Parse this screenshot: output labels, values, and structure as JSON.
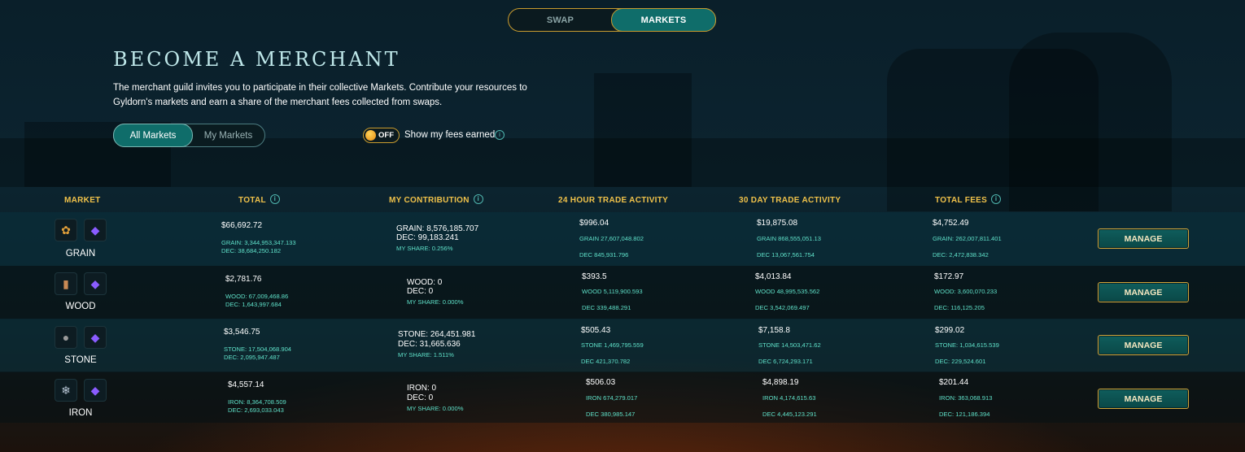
{
  "nav": {
    "tabs": [
      "SWAP",
      "MARKETS"
    ],
    "active": "MARKETS"
  },
  "page": {
    "title": "BECOME A MERCHANT",
    "description": "The merchant guild invites you to participate in their collective Markets. Contribute your resources to Gyldorn's markets and earn a share of the merchant fees collected from swaps."
  },
  "filter": {
    "all": "All Markets",
    "mine": "My Markets",
    "selected": "All Markets"
  },
  "fees_toggle": {
    "state": "OFF",
    "label": "Show my fees earned"
  },
  "columns": {
    "market": "MARKET",
    "total": "TOTAL",
    "contribution": "MY CONTRIBUTION",
    "day": "24 HOUR TRADE ACTIVITY",
    "month": "30 DAY TRADE ACTIVITY",
    "fees": "TOTAL FEES"
  },
  "markets": [
    {
      "name": "GRAIN",
      "resource_icon": "grain-icon",
      "token_icon": "dec-crystal-icon",
      "total": {
        "value": "$66,692.72",
        "line1": "GRAIN: 3,344,953,347.133",
        "line2": "DEC: 38,684,250.182"
      },
      "contrib": {
        "line1": "GRAIN:  8,576,185.707",
        "line2": "DEC:   99,183.241",
        "share": "MY SHARE: 0.256%"
      },
      "day": {
        "value": "$996.04",
        "line1": "GRAIN 27,607,048.802",
        "line2": "DEC 845,931.796"
      },
      "month": {
        "value": "$19,875.08",
        "line1": "GRAIN 868,555,051.13",
        "line2": "DEC 13,067,561.754"
      },
      "fees": {
        "value": "$4,752.49",
        "line1": "GRAIN: 262,007,811.401",
        "line2": "DEC: 2,472,838.342"
      },
      "button": "MANAGE"
    },
    {
      "name": "WOOD",
      "resource_icon": "wood-log-icon",
      "token_icon": "dec-crystal-icon",
      "total": {
        "value": "$2,781.76",
        "line1": "WOOD: 67,009,468.86",
        "line2": "DEC: 1,643,997.684"
      },
      "contrib": {
        "line1": "WOOD:   0",
        "line2": "DEC:   0",
        "share": "MY SHARE: 0.000%"
      },
      "day": {
        "value": "$393.5",
        "line1": "WOOD 5,119,900.593",
        "line2": "DEC 339,488.291"
      },
      "month": {
        "value": "$4,013.84",
        "line1": "WOOD 48,995,535.562",
        "line2": "DEC 3,542,069.497"
      },
      "fees": {
        "value": "$172.97",
        "line1": "WOOD: 3,600,070.233",
        "line2": "DEC: 116,125.205"
      },
      "button": "MANAGE"
    },
    {
      "name": "STONE",
      "resource_icon": "stone-icon",
      "token_icon": "dec-crystal-icon",
      "total": {
        "value": "$3,546.75",
        "line1": "STONE: 17,504,068.904",
        "line2": "DEC: 2,095,947.487"
      },
      "contrib": {
        "line1": "STONE:   264,451.981",
        "line2": "DEC:    31,665.636",
        "share": "MY SHARE: 1.511%"
      },
      "day": {
        "value": "$505.43",
        "line1": "STONE 1,469,795.559",
        "line2": "DEC 421,370.782"
      },
      "month": {
        "value": "$7,158.8",
        "line1": "STONE 14,503,471.62",
        "line2": "DEC 6,724,293.171"
      },
      "fees": {
        "value": "$299.02",
        "line1": "STONE: 1,034,615.539",
        "line2": "DEC: 229,524.601"
      },
      "button": "MANAGE"
    },
    {
      "name": "IRON",
      "resource_icon": "iron-ore-icon",
      "token_icon": "dec-crystal-icon",
      "total": {
        "value": "$4,557.14",
        "line1": "IRON: 8,364,708.509",
        "line2": "DEC: 2,693,033.043"
      },
      "contrib": {
        "line1": "IRON:   0",
        "line2": "DEC:   0",
        "share": "MY SHARE: 0.000%"
      },
      "day": {
        "value": "$506.03",
        "line1": "IRON 674,279.017",
        "line2": "DEC 380,985.147"
      },
      "month": {
        "value": "$4,898.19",
        "line1": "IRON 4,174,615.63",
        "line2": "DEC 4,445,123.291"
      },
      "fees": {
        "value": "$201.44",
        "line1": "IRON: 363,068.913",
        "line2": "DEC: 121,186.394"
      },
      "button": "MANAGE"
    }
  ],
  "colors": {
    "accent_gold": "#f0c24a",
    "teal": "#0f6d6a",
    "value_green": "#5fe0c8",
    "title": "#bfe8ea"
  }
}
